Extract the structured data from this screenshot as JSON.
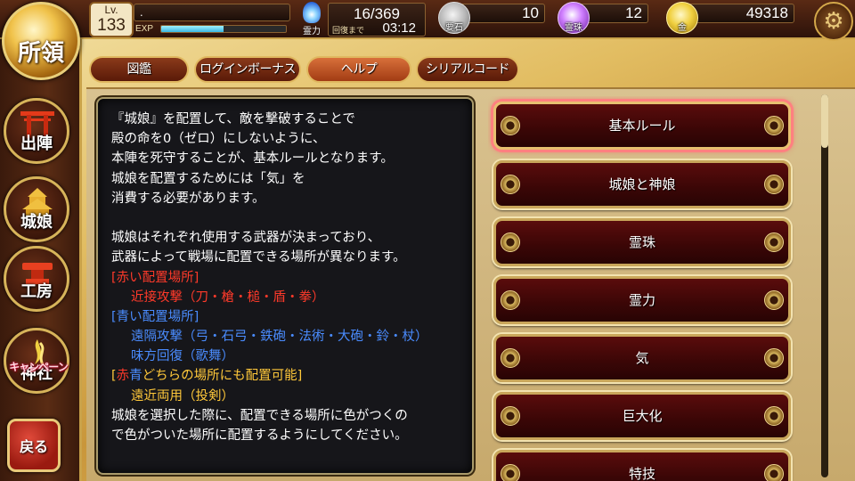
{
  "header": {
    "title": "所領",
    "level_label": "Lv.",
    "level": "133",
    "player_name": ".",
    "exp_label": "EXP",
    "exp_progress": 0.5,
    "stamina_label": "霊力",
    "stamina": "16/369",
    "recovery_label": "回復まで",
    "recovery_time": "03:12",
    "stone_label": "要石",
    "stones": "10",
    "orb_label": "霊珠",
    "orbs": "12",
    "gold_label": "金",
    "gold": "49318",
    "settings_icon": "gear-icon"
  },
  "sidebar": {
    "items": [
      {
        "label": "出陣",
        "icon": "torii-gate-icon"
      },
      {
        "label": "城娘",
        "icon": "castle-girl-icon"
      },
      {
        "label": "工房",
        "icon": "anvil-icon"
      },
      {
        "label": "神社",
        "icon": "shrine-icon"
      }
    ],
    "campaign_badge": "キャンペーン",
    "back_label": "戻る"
  },
  "tabs": [
    {
      "label": "図鑑",
      "active": false
    },
    {
      "label": "ログインボーナス",
      "active": false
    },
    {
      "label": "ヘルプ",
      "active": true
    },
    {
      "label": "シリアルコード",
      "active": false
    }
  ],
  "help_text": {
    "l1": "『城娘』を配置して、敵を撃破することで",
    "l2": "殿の命を0（ゼロ）にしないように、",
    "l3": "本陣を死守することが、基本ルールとなります。",
    "l4": "城娘を配置するためには「気」を",
    "l5": "消費する必要があります。",
    "l7": "城娘はそれぞれ使用する武器が決まっており、",
    "l8": "武器によって戦場に配置できる場所が異なります。",
    "red_heading": "[赤い配置場所]",
    "red_body": "近接攻撃（刀・槍・槌・盾・拳）",
    "blue_heading": "[青い配置場所]",
    "blue_body1": "遠隔攻撃（弓・石弓・鉄砲・法術・大砲・鈴・杖）",
    "blue_body2": "味方回復（歌舞）",
    "both_open": "[",
    "both_red": "赤",
    "both_blue": "青",
    "both_rest": "どちらの場所にも配置可能]",
    "both_body": "遠近両用（投剣）",
    "l_end1": "城娘を選択した際に、配置できる場所に色がつくの",
    "l_end2": "で色がついた場所に配置するようにしてください。"
  },
  "help_topics": [
    {
      "label": "基本ルール",
      "selected": true
    },
    {
      "label": "城娘と神娘",
      "selected": false
    },
    {
      "label": "霊珠",
      "selected": false
    },
    {
      "label": "霊力",
      "selected": false
    },
    {
      "label": "気",
      "selected": false
    },
    {
      "label": "巨大化",
      "selected": false
    },
    {
      "label": "特技",
      "selected": false
    }
  ],
  "colors": {
    "red_zone": "#ff3a2a",
    "blue_zone": "#4a8cff",
    "gold_heading": "#ffc83a",
    "panel_bg": "#16161a",
    "topic_bg": "#3a0606"
  }
}
